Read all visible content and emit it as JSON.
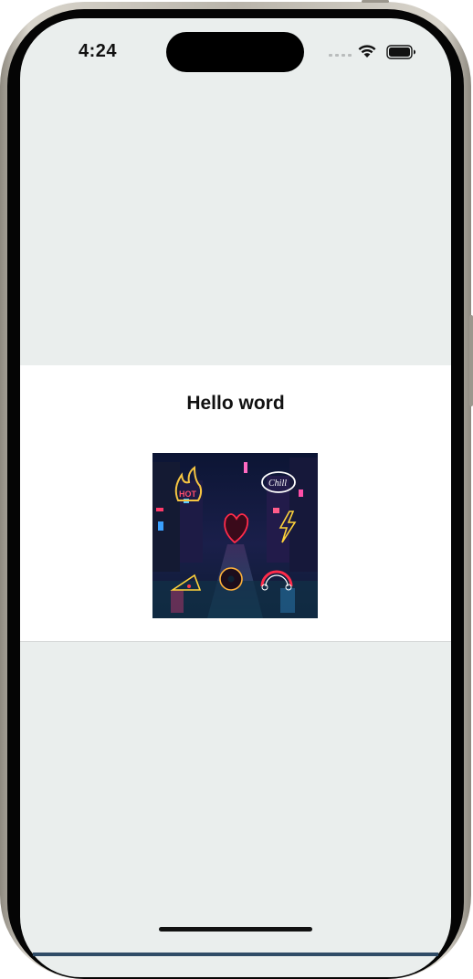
{
  "status_bar": {
    "time": "4:24",
    "signal_icon": "cellular-signal-icon",
    "wifi_icon": "wifi-icon",
    "battery_icon": "battery-icon"
  },
  "card": {
    "title": "Hello word",
    "image": {
      "description_icon": "neon-street-image",
      "sticker_text": [
        "HOT",
        "Chill"
      ]
    }
  },
  "colors": {
    "screen_background": "#eaeeed",
    "card_background": "#ffffff",
    "text": "#111111"
  }
}
